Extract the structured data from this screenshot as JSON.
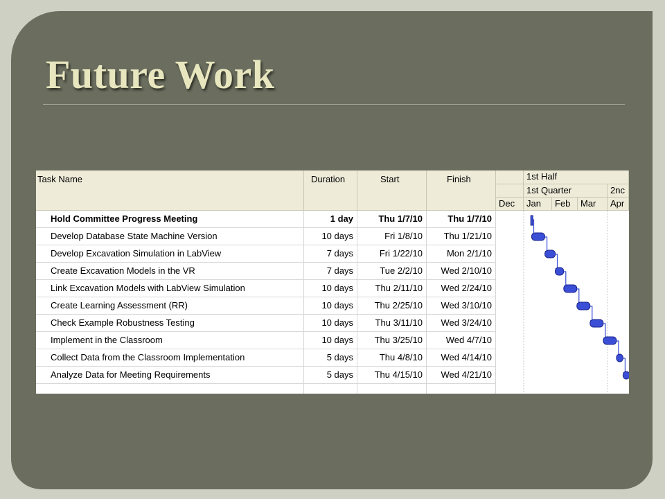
{
  "slide": {
    "title": "Future Work"
  },
  "gantt": {
    "columns": {
      "task_name": "Task Name",
      "duration": "Duration",
      "start": "Start",
      "finish": "Finish"
    },
    "timescale": {
      "half": "1st Half",
      "quarter1": "1st Quarter",
      "quarter2": "2nc",
      "months": [
        "Dec",
        "Jan",
        "Feb",
        "Mar",
        "Apr"
      ]
    },
    "tasks": [
      {
        "name": "Hold Committee Progress Meeting",
        "duration": "1 day",
        "start": "Thu 1/7/10",
        "finish": "Thu 1/7/10",
        "bold": true
      },
      {
        "name": "Develop Database State Machine Version",
        "duration": "10 days",
        "start": "Fri 1/8/10",
        "finish": "Thu 1/21/10"
      },
      {
        "name": "Develop Excavation Simulation in LabView",
        "duration": "7 days",
        "start": "Fri 1/22/10",
        "finish": "Mon 2/1/10"
      },
      {
        "name": "Create Excavation Models in the VR",
        "duration": "7 days",
        "start": "Tue 2/2/10",
        "finish": "Wed 2/10/10"
      },
      {
        "name": "Link Excavation Models with LabView Simulation",
        "duration": "10 days",
        "start": "Thu 2/11/10",
        "finish": "Wed 2/24/10"
      },
      {
        "name": "Create Learning Assessment (RR)",
        "duration": "10 days",
        "start": "Thu 2/25/10",
        "finish": "Wed 3/10/10"
      },
      {
        "name": "Check Example Robustness Testing",
        "duration": "10 days",
        "start": "Thu 3/11/10",
        "finish": "Wed 3/24/10"
      },
      {
        "name": "Implement in the Classroom",
        "duration": "10 days",
        "start": "Thu 3/25/10",
        "finish": "Wed 4/7/10"
      },
      {
        "name": "Collect Data from the Classroom Implementation",
        "duration": "5 days",
        "start": "Thu 4/8/10",
        "finish": "Wed 4/14/10"
      },
      {
        "name": "Analyze Data  for Meeting Requirements",
        "duration": "5 days",
        "start": "Thu 4/15/10",
        "finish": "Wed 4/21/10"
      }
    ],
    "bar_color": "#3b4fd6"
  }
}
